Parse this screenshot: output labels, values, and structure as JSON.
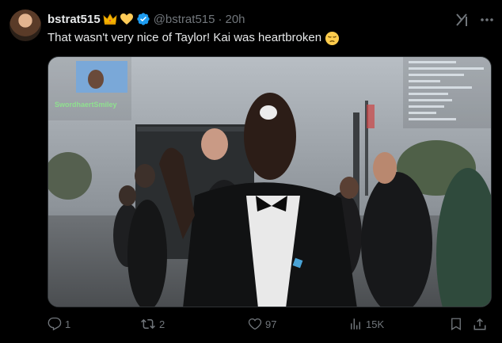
{
  "post": {
    "display_name": "bstrat515",
    "handle": "@bstrat515",
    "separator": "·",
    "time": "20h",
    "text": "That wasn't very nice of Taylor! Kai was heartbroken"
  },
  "media": {
    "stream_overlay_name": "SwordhaertSmiley",
    "chat_lines": [
      "",
      "",
      "",
      "",
      "",
      "",
      "",
      "",
      "",
      "",
      "",
      ""
    ]
  },
  "actions": {
    "replies": "1",
    "reposts": "2",
    "likes": "97",
    "views": "15K"
  },
  "colors": {
    "background": "#000000",
    "text": "#e7e9ea",
    "muted": "#71767b",
    "verified": "#1d9bf0"
  },
  "icons": [
    "crown-emoji",
    "yellow-heart-emoji",
    "verified-badge-icon",
    "grok-icon",
    "more-icon",
    "pensive-face-emoji",
    "reply-icon",
    "repost-icon",
    "like-icon",
    "views-icon",
    "bookmark-icon",
    "share-icon"
  ]
}
